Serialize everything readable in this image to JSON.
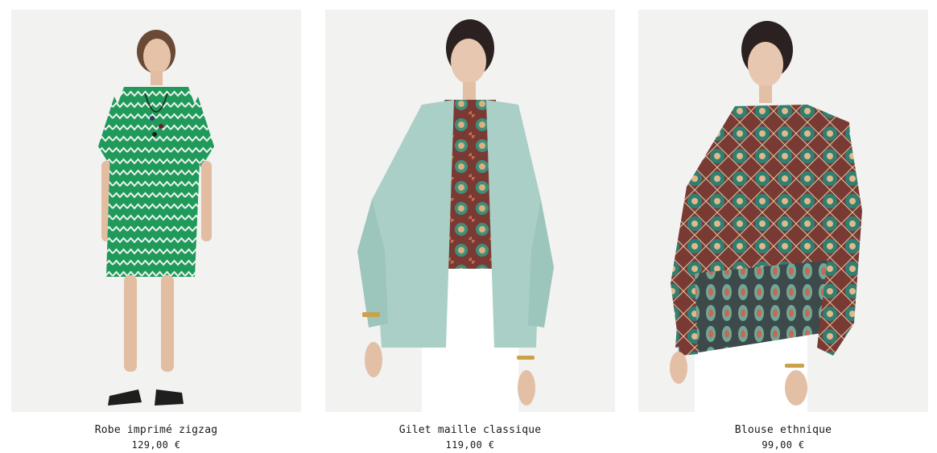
{
  "products": [
    {
      "name": "Robe imprimé zigzag",
      "price": "129,00 €",
      "image": "green-zigzag-print-dress"
    },
    {
      "name": "Gilet maille classique",
      "price": "119,00 €",
      "image": "mint-knit-cardigan"
    },
    {
      "name": "Blouse ethnique",
      "price": "99,00 €",
      "image": "paisley-print-blouse"
    }
  ],
  "colors": {
    "photo_background": "#f2f2f1",
    "dress_green": "#1f9a5a",
    "cardigan_mint": "#a9cfc6",
    "blouse_burgundy": "#7a3a34"
  }
}
